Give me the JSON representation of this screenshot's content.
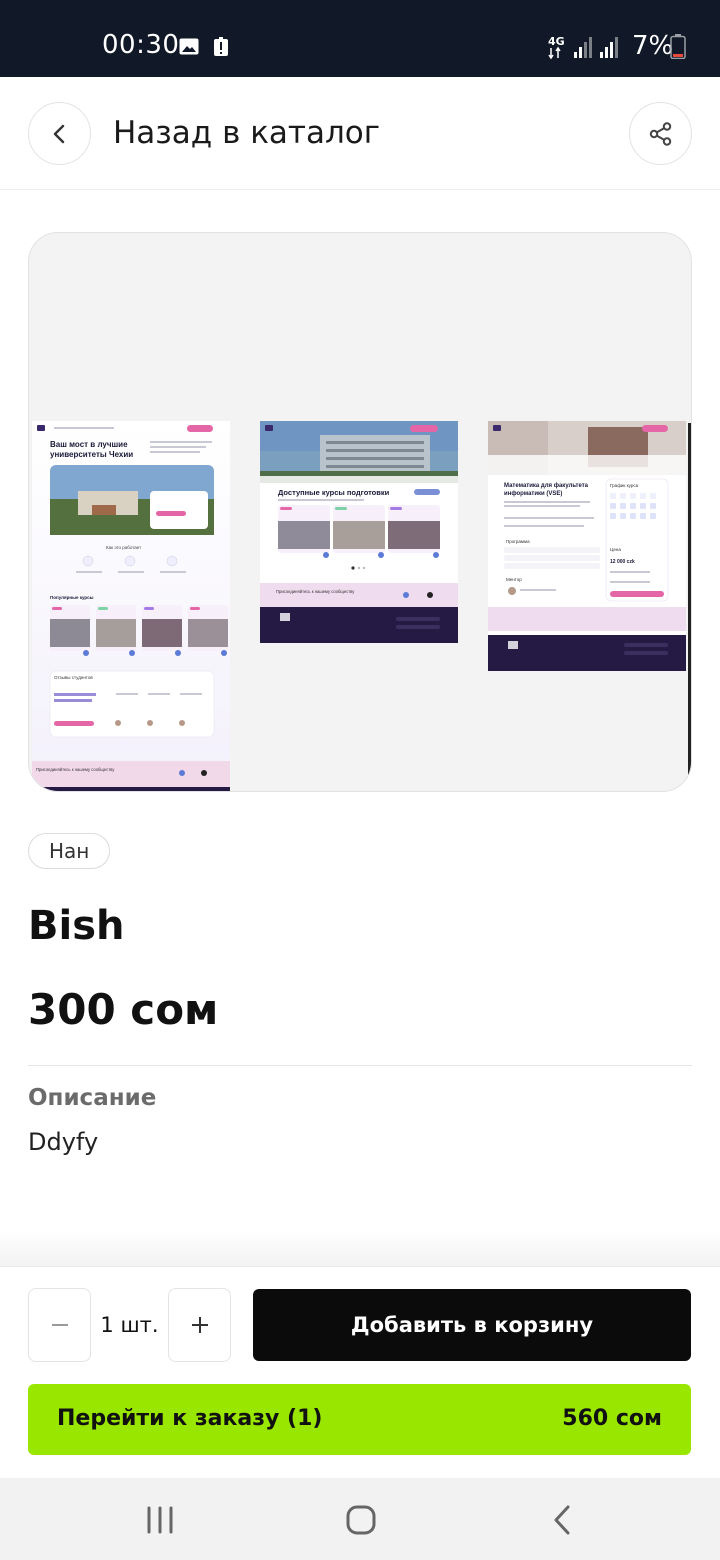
{
  "status_bar": {
    "time": "00:30",
    "network": "4G",
    "battery": "7%",
    "icons": [
      "image-icon",
      "alert-icon",
      "signal-icon",
      "battery-icon"
    ]
  },
  "header": {
    "title": "Назад в каталог",
    "back_icon": "chevron-left-icon",
    "share_icon": "share-icon"
  },
  "gallery": {
    "slides": [
      {
        "heading": "Ваш мост в лучшие университеты Чехии",
        "section_1": "Как это работает",
        "section_2": "Популярные курсы",
        "section_3": "Отзывы студентов",
        "footer_band": "Присоединяйтесь к нашему сообществу"
      },
      {
        "heading": "Доступные курсы подготовки",
        "footer_band": "Присоединяйтесь к нашему сообществу"
      },
      {
        "heading": "Математика для факультета информатики (VSE)",
        "side_title": "График курса",
        "price_label": "Цена",
        "price_value": "12 000 czk",
        "program_label": "Программа",
        "mentor_label": "Ментор"
      }
    ]
  },
  "product": {
    "tag": "Нан",
    "title": "Bish",
    "price": "300 сом",
    "description_label": "Описание",
    "description": "Ddyfy"
  },
  "cart": {
    "quantity": "1 шт.",
    "add_button": "Добавить в корзину",
    "checkout_label": "Перейти к заказу (1)",
    "checkout_total": "560 сом",
    "accent_color": "#99e600"
  },
  "nav": {
    "icons": [
      "recent-apps-icon",
      "home-icon",
      "back-icon"
    ]
  }
}
